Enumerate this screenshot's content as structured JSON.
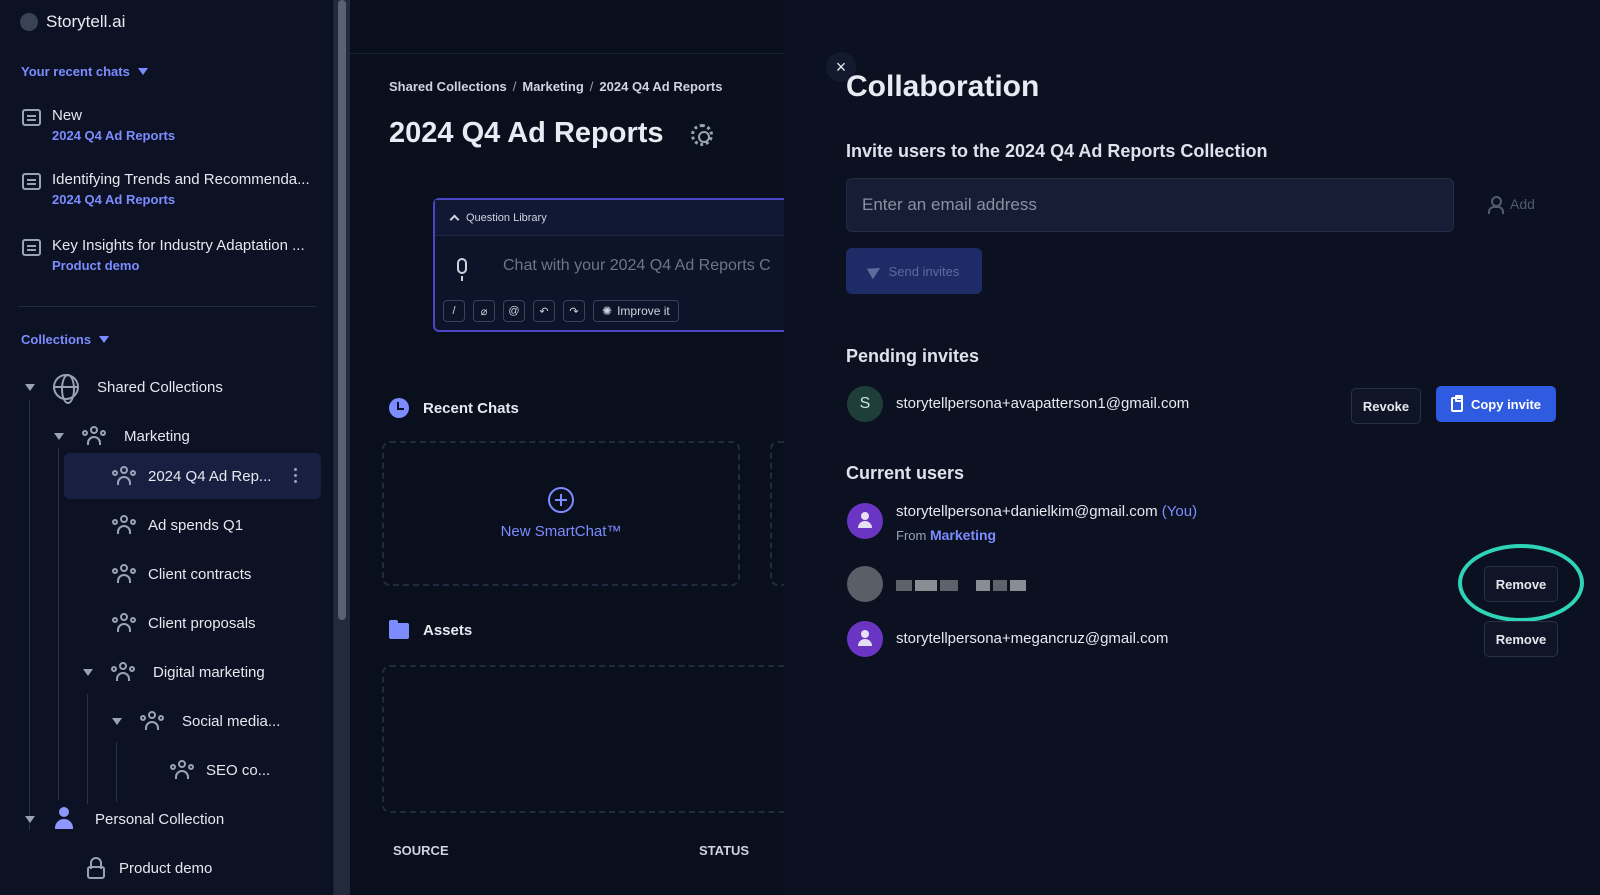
{
  "app": {
    "brand": "Storytell.ai"
  },
  "sidebar": {
    "recent_heading": "Your recent chats",
    "recent_chats": [
      {
        "title": "New",
        "collection": "2024 Q4 Ad Reports"
      },
      {
        "title": "Identifying Trends and Recommenda...",
        "collection": "2024 Q4 Ad Reports"
      },
      {
        "title": "Key Insights for Industry Adaptation ...",
        "collection": "Product demo"
      }
    ],
    "collections_heading": "Collections",
    "tree": {
      "shared": "Shared Collections",
      "marketing": "Marketing",
      "q4": "2024 Q4 Ad Rep...",
      "adspends": "Ad spends Q1",
      "contracts": "Client contracts",
      "proposals": "Client proposals",
      "digital": "Digital marketing",
      "social": "Social media...",
      "seo": "SEO co...",
      "personal": "Personal Collection",
      "product_demo": "Product demo"
    }
  },
  "main": {
    "breadcrumb": [
      "Shared Collections",
      "Marketing",
      "2024 Q4 Ad Reports"
    ],
    "breadcrumb_sep": "/",
    "title": "2024 Q4 Ad Reports",
    "question_library": "Question Library",
    "chat_placeholder": "Chat with your 2024 Q4 Ad Reports C",
    "improve_label": "Improve it",
    "recent_chats_heading": "Recent Chats",
    "new_smartchat": "New SmartChat™",
    "assets_heading": "Assets",
    "table_columns": {
      "source": "SOURCE",
      "status": "STATUS"
    }
  },
  "collab": {
    "close_glyph": "×",
    "title": "Collaboration",
    "invite_heading": "Invite users to the 2024 Q4 Ad Reports Collection",
    "email_placeholder": "Enter an email address",
    "add_label": "Add",
    "send_label": "Send invites",
    "pending_heading": "Pending invites",
    "pending": [
      {
        "initial": "S",
        "email": "storytellpersona+avapatterson1@gmail.com",
        "revoke_label": "Revoke",
        "copy_label": "Copy invite"
      }
    ],
    "current_heading": "Current users",
    "users": [
      {
        "email": "storytellpersona+danielkim@gmail.com",
        "you": "(You)",
        "from_prefix": "From",
        "from": "Marketing"
      },
      {
        "remove_label": "Remove"
      },
      {
        "email": "storytellpersona+megancruz@gmail.com",
        "remove_label": "Remove"
      }
    ]
  },
  "colors": {
    "accent": "#7c8cff",
    "primary_button": "#2f5be0",
    "highlight_ring": "#2fd3b8",
    "background": "#0a0f1e"
  },
  "icons": [
    "chat-bubble-icon",
    "caret-down-icon",
    "globe-icon",
    "people-icon",
    "person-icon",
    "lock-icon",
    "gear-icon",
    "microphone-icon",
    "clock-icon",
    "folder-icon",
    "plus-circle-icon",
    "close-icon",
    "add-user-icon",
    "send-icon",
    "clipboard-icon"
  ]
}
